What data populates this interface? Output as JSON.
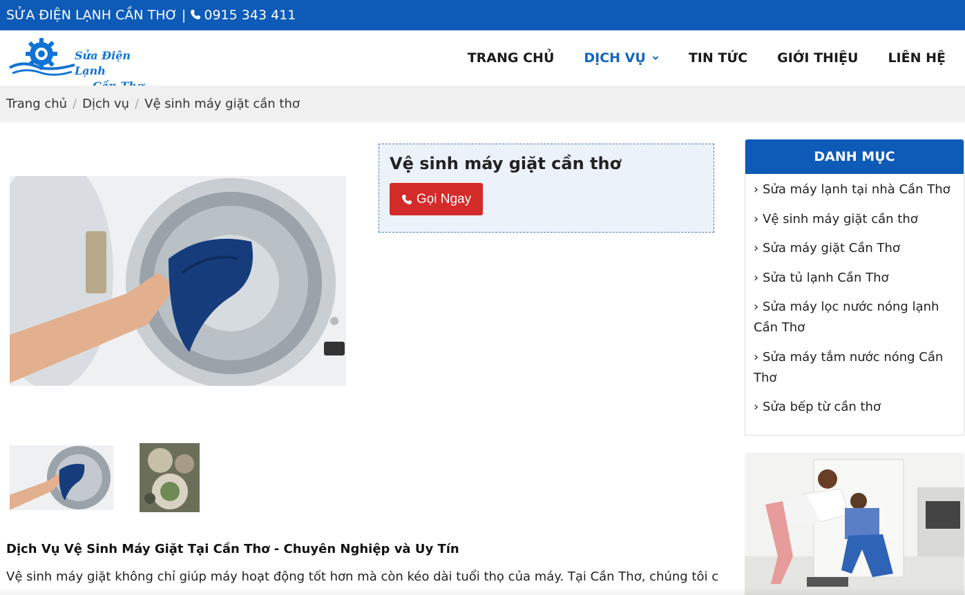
{
  "topbar": {
    "site_name": "SỬA ĐIỆN LẠNH CẦN THƠ",
    "divider": "|",
    "phone": "0915 343 411"
  },
  "logo": {
    "line1": "Sửa Điện Lạnh",
    "line2": "Cần Thơ",
    "color": "#1173d4"
  },
  "nav": {
    "items": [
      {
        "label": "TRANG CHỦ"
      },
      {
        "label": "DỊCH VỤ"
      },
      {
        "label": "TIN TỨC"
      },
      {
        "label": "GIỚI THIỆU"
      },
      {
        "label": "LIÊN HỆ"
      }
    ]
  },
  "breadcrumb": {
    "items": [
      "Trang chủ",
      "Dịch vụ",
      "Vệ sinh máy giặt cần thơ"
    ],
    "separator": "/"
  },
  "product": {
    "title": "Vệ sinh máy giặt cần thơ",
    "call_label": "Gọi Ngay"
  },
  "article": {
    "heading": "Dịch Vụ Vệ Sinh Máy Giặt Tại Cần Thơ - Chuyên Nghiệp và Uy Tín",
    "paragraph": "Vệ sinh máy giặt không chỉ giúp máy hoạt động tốt hơn mà còn kéo dài tuổi thọ của máy. Tại Cần Thơ, chúng tôi cung cấp"
  },
  "sidebar": {
    "title": "DANH MỤC",
    "items": [
      "Sửa máy lạnh tại nhà Cần Thơ",
      "Vệ sinh máy giặt cần thơ",
      "Sửa máy giặt Cần Thơ",
      "Sửa tủ lạnh Cần Thơ",
      "Sửa máy lọc nước nóng lạnh Cần Thơ",
      "Sửa máy tắm nước nóng Cần Thơ",
      "Sửa bếp từ cần thơ"
    ]
  },
  "colors": {
    "brand_blue": "#0e5ab7",
    "accent_red": "#d32a2a",
    "nav_active": "#1565c0",
    "breadcrumb_bg": "#f0f0f0"
  },
  "icons": {
    "phone": "phone-icon",
    "dropdown": "chevron-down-icon",
    "list_arrow": "chevron-right-icon"
  }
}
